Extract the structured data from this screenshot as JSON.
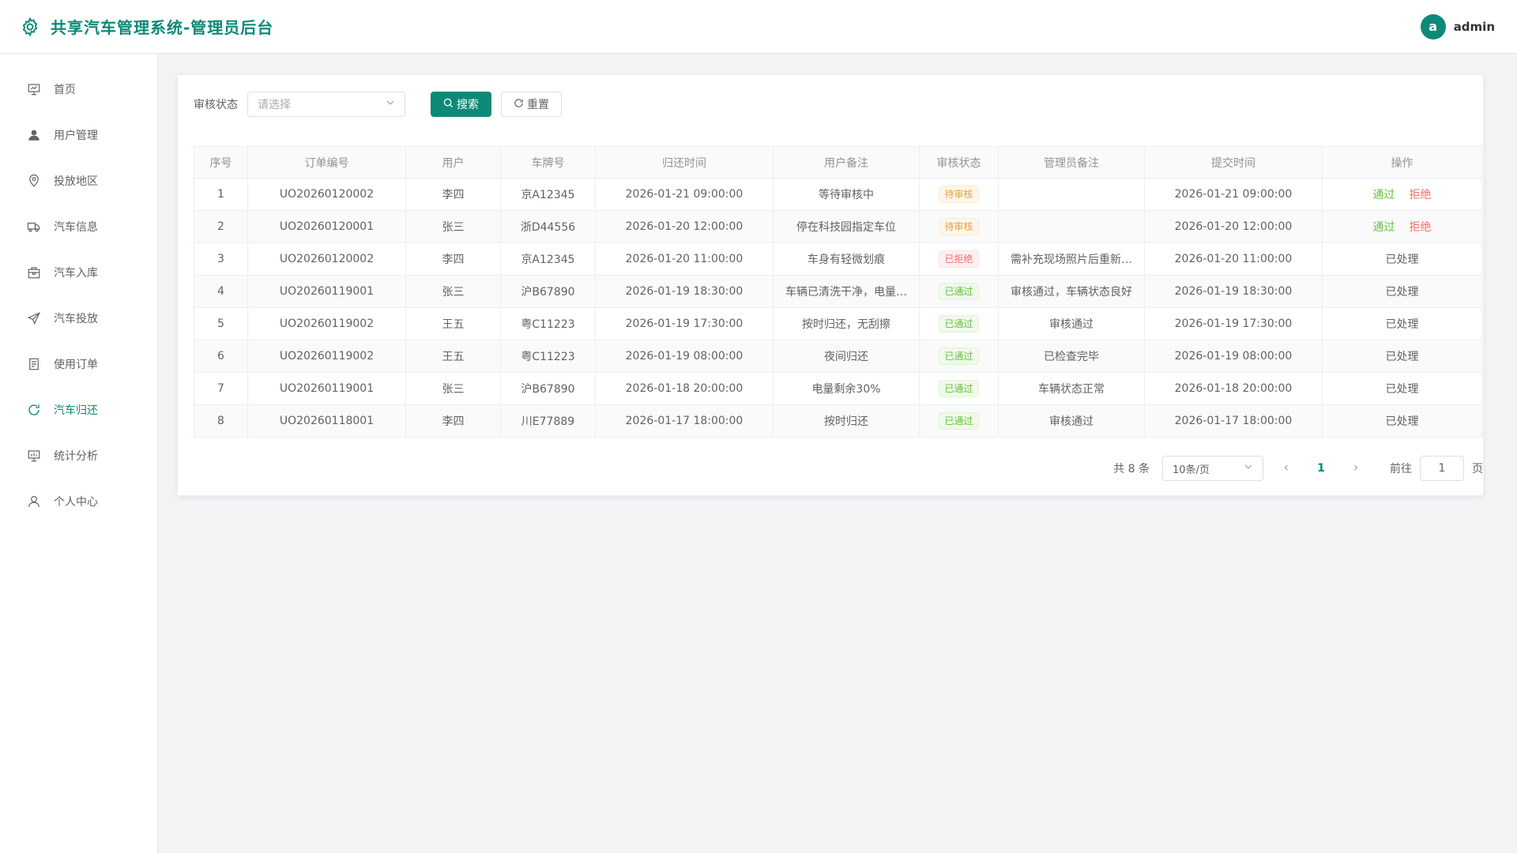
{
  "header": {
    "title": "共享汽车管理系统-管理员后台",
    "avatar_letter": "a",
    "username": "admin",
    "accent": "#0d8a77"
  },
  "sidebar": {
    "items": [
      {
        "label": "首页",
        "icon": "presentation-icon",
        "active": false
      },
      {
        "label": "用户管理",
        "icon": "user-filled-icon",
        "active": false
      },
      {
        "label": "投放地区",
        "icon": "location-icon",
        "active": false
      },
      {
        "label": "汽车信息",
        "icon": "truck-icon",
        "active": false
      },
      {
        "label": "汽车入库",
        "icon": "box-icon",
        "active": false
      },
      {
        "label": "汽车投放",
        "icon": "send-icon",
        "active": false
      },
      {
        "label": "使用订单",
        "icon": "document-icon",
        "active": false
      },
      {
        "label": "汽车归还",
        "icon": "refresh-icon",
        "active": true
      },
      {
        "label": "统计分析",
        "icon": "chart-board-icon",
        "active": false
      },
      {
        "label": "个人中心",
        "icon": "user-icon",
        "active": false
      }
    ]
  },
  "filter": {
    "label": "审核状态",
    "placeholder": "请选择",
    "search_label": "搜索",
    "reset_label": "重置"
  },
  "table": {
    "columns": [
      "序号",
      "订单编号",
      "用户",
      "车牌号",
      "归还时间",
      "用户备注",
      "审核状态",
      "管理员备注",
      "提交时间",
      "操作"
    ],
    "rows": [
      {
        "no": "1",
        "order": "UO20260120002",
        "user": "李四",
        "plate": "京A12345",
        "return_time": "2026-01-21 09:00:00",
        "user_note": "等待审核中",
        "status": "待审核",
        "status_type": "warning",
        "admin_note": "",
        "submit_time": "2026-01-21 09:00:00",
        "pending": true
      },
      {
        "no": "2",
        "order": "UO20260120001",
        "user": "张三",
        "plate": "浙D44556",
        "return_time": "2026-01-20 12:00:00",
        "user_note": "停在科技园指定车位",
        "status": "待审核",
        "status_type": "warning",
        "admin_note": "",
        "submit_time": "2026-01-20 12:00:00",
        "pending": true
      },
      {
        "no": "3",
        "order": "UO20260120002",
        "user": "李四",
        "plate": "京A12345",
        "return_time": "2026-01-20 11:00:00",
        "user_note": "车身有轻微划痕",
        "status": "已拒绝",
        "status_type": "danger",
        "admin_note": "需补充现场照片后重新…",
        "submit_time": "2026-01-20 11:00:00",
        "pending": false
      },
      {
        "no": "4",
        "order": "UO20260119001",
        "user": "张三",
        "plate": "沪B67890",
        "return_time": "2026-01-19 18:30:00",
        "user_note": "车辆已清洗干净，电量…",
        "status": "已通过",
        "status_type": "success",
        "admin_note": "审核通过，车辆状态良好",
        "submit_time": "2026-01-19 18:30:00",
        "pending": false
      },
      {
        "no": "5",
        "order": "UO20260119002",
        "user": "王五",
        "plate": "粤C11223",
        "return_time": "2026-01-19 17:30:00",
        "user_note": "按时归还，无刮擦",
        "status": "已通过",
        "status_type": "success",
        "admin_note": "审核通过",
        "submit_time": "2026-01-19 17:30:00",
        "pending": false
      },
      {
        "no": "6",
        "order": "UO20260119002",
        "user": "王五",
        "plate": "粤C11223",
        "return_time": "2026-01-19 08:00:00",
        "user_note": "夜间归还",
        "status": "已通过",
        "status_type": "success",
        "admin_note": "已检查完毕",
        "submit_time": "2026-01-19 08:00:00",
        "pending": false
      },
      {
        "no": "7",
        "order": "UO20260119001",
        "user": "张三",
        "plate": "沪B67890",
        "return_time": "2026-01-18 20:00:00",
        "user_note": "电量剩余30%",
        "status": "已通过",
        "status_type": "success",
        "admin_note": "车辆状态正常",
        "submit_time": "2026-01-18 20:00:00",
        "pending": false
      },
      {
        "no": "8",
        "order": "UO20260118001",
        "user": "李四",
        "plate": "川E77889",
        "return_time": "2026-01-17 18:00:00",
        "user_note": "按时归还",
        "status": "已通过",
        "status_type": "success",
        "admin_note": "审核通过",
        "submit_time": "2026-01-17 18:00:00",
        "pending": false
      }
    ],
    "approve_label": "通过",
    "reject_label": "拒绝",
    "processed_label": "已处理"
  },
  "pagination": {
    "total_text": "共 8 条",
    "page_size": "10条/页",
    "current_page": "1",
    "goto_label": "前往",
    "goto_value": "1",
    "page_suffix": "页"
  }
}
